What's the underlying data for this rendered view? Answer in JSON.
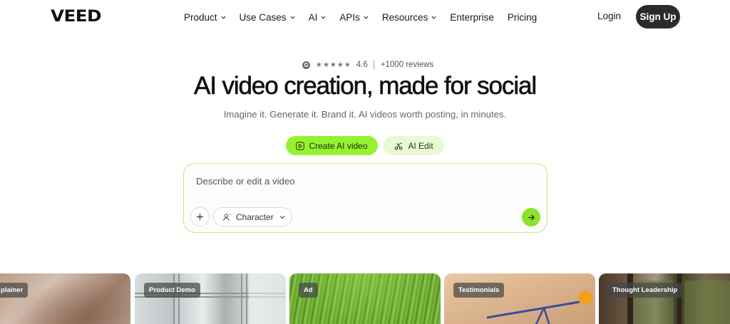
{
  "nav": {
    "logo": "VEED",
    "menu": [
      {
        "label": "Product",
        "dropdown": true
      },
      {
        "label": "Use Cases",
        "dropdown": true
      },
      {
        "label": "AI",
        "dropdown": true
      },
      {
        "label": "APIs",
        "dropdown": true
      },
      {
        "label": "Resources",
        "dropdown": true
      },
      {
        "label": "Enterprise",
        "dropdown": false
      },
      {
        "label": "Pricing",
        "dropdown": false
      }
    ],
    "login": "Login",
    "signup": "Sign Up"
  },
  "hero": {
    "rating": {
      "icon": "google-g-icon",
      "stars": "★★★★★",
      "score": "4.6",
      "reviews": "+1000 reviews"
    },
    "headline": "AI video creation, made for social",
    "subhead": "Imagine it. Generate it. Brand it. AI videos worth posting, in minutes.",
    "primary_button": "Create AI video",
    "secondary_button": "AI Edit"
  },
  "prompt": {
    "placeholder": "Describe or edit a video",
    "character_label": "Character"
  },
  "cards": [
    {
      "tag": "plainer"
    },
    {
      "tag": "Product Demo"
    },
    {
      "tag": "Ad"
    },
    {
      "tag": "Testimonials"
    },
    {
      "tag": "Thought Leadership"
    }
  ],
  "colors": {
    "accent": "#96f230",
    "accent_soft": "#e8f9d4",
    "send": "#8be22a",
    "dark": "#2b2b2b"
  }
}
